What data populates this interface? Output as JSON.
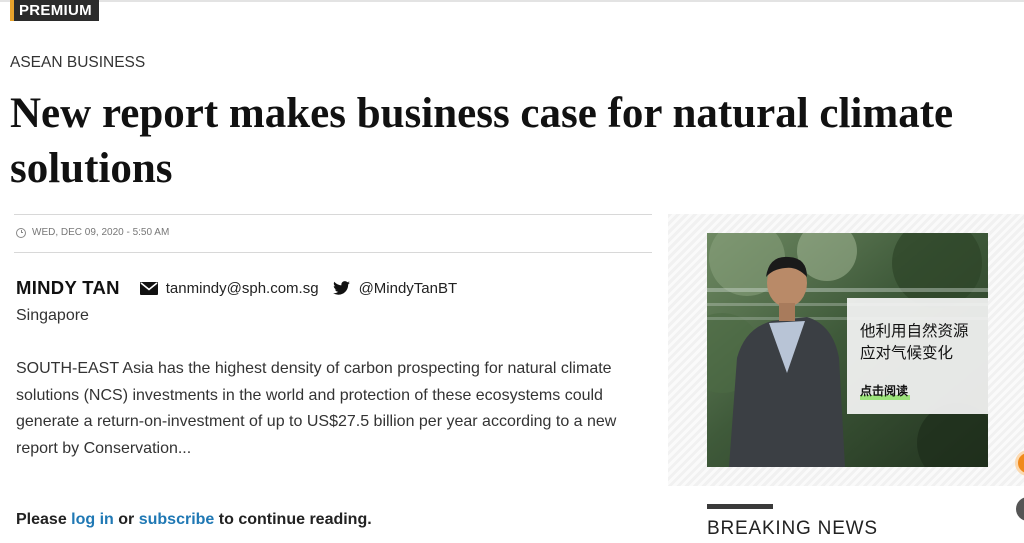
{
  "header": {
    "badge": "PREMIUM"
  },
  "article": {
    "category": "ASEAN BUSINESS",
    "headline_line1": "New report makes business case for natural climate",
    "headline_line2": "solutions",
    "date": "WED, DEC 09, 2020 - 5:50 AM",
    "author": {
      "name": "MINDY TAN",
      "email": "tanmindy@sph.com.sg",
      "twitter": "@MindyTanBT",
      "location": "Singapore"
    },
    "summary": "SOUTH-EAST Asia has the highest density of carbon prospecting for natural climate solutions (NCS) investments in the world and protection of these ecosystems could generate a return-on-investment of up to US$27.5 billion per year according to a new report by Conservation...",
    "paywall": {
      "prefix": "Please",
      "login": "log in",
      "or": "or",
      "subscribe": "subscribe",
      "suffix": "to continue reading."
    }
  },
  "sidebar": {
    "ad": {
      "line1": "他利用自然资源",
      "line2": "应对气候变化",
      "cta": "点击阅读"
    },
    "section_title": "BREAKING NEWS"
  },
  "colors": {
    "link": "#1f78b4",
    "badge_accent": "#e8a32c",
    "cta_highlight": "#9be27a"
  }
}
